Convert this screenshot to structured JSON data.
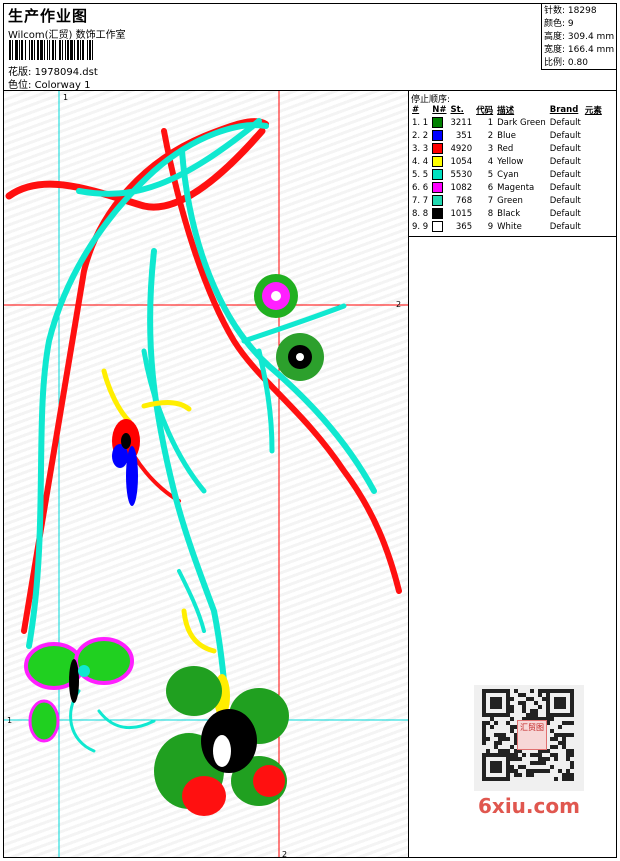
{
  "header": {
    "title": "生产作业图",
    "company": "Wilcom(汇贸) 数饰工作室",
    "file_label": "花版:",
    "file_value": "1978094.dst",
    "color_label": "色位:",
    "color_value": "Colorway 1"
  },
  "stats": [
    {
      "label": "针数:",
      "value": "18298"
    },
    {
      "label": "颜色:",
      "value": "9"
    },
    {
      "label": "高度:",
      "value": "309.4 mm"
    },
    {
      "label": "宽度:",
      "value": "166.4 mm"
    },
    {
      "label": "比例:",
      "value": "0.80"
    }
  ],
  "sequence": {
    "title": "停止顺序:",
    "headers": [
      "#",
      "N#",
      "St.",
      "代码",
      "描述",
      "Brand",
      "元素"
    ],
    "rows": [
      {
        "idx": "1. 1",
        "color": "#008000",
        "st": "3211",
        "code": "1",
        "desc": "Dark Green",
        "brand": "Default"
      },
      {
        "idx": "2. 2",
        "color": "#0000ff",
        "st": "351",
        "code": "2",
        "desc": "Blue",
        "brand": "Default"
      },
      {
        "idx": "3. 3",
        "color": "#ff0000",
        "st": "4920",
        "code": "3",
        "desc": "Red",
        "brand": "Default"
      },
      {
        "idx": "4. 4",
        "color": "#ffff00",
        "st": "1054",
        "code": "4",
        "desc": "Yellow",
        "brand": "Default"
      },
      {
        "idx": "5. 5",
        "color": "#00e0c0",
        "st": "5530",
        "code": "5",
        "desc": "Cyan",
        "brand": "Default"
      },
      {
        "idx": "6. 6",
        "color": "#ff00ff",
        "st": "1082",
        "code": "6",
        "desc": "Magenta",
        "brand": "Default"
      },
      {
        "idx": "7. 7",
        "color": "#20d8b0",
        "st": "768",
        "code": "7",
        "desc": "Green",
        "brand": "Default"
      },
      {
        "idx": "8. 8",
        "color": "#000000",
        "st": "1015",
        "code": "8",
        "desc": "Black",
        "brand": "Default"
      },
      {
        "idx": "9. 9",
        "color": "#ffffff",
        "st": "365",
        "code": "9",
        "desc": "White",
        "brand": "Default"
      }
    ]
  },
  "guides": {
    "v1": "1",
    "h1": "1",
    "v2": "2",
    "h2": "2"
  },
  "watermark": {
    "text": "6xiu.com",
    "stamp": "汇贸图"
  }
}
